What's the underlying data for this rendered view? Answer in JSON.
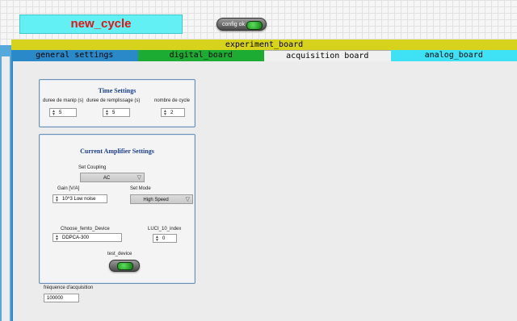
{
  "header": {
    "title": "new_cycle",
    "config_button_label": "config ok"
  },
  "experiment_bar": {
    "label": "experiment_board"
  },
  "tabs": [
    {
      "label": "general settings",
      "color": "#2a89c9"
    },
    {
      "label": "digital_board",
      "color": "#1cab33"
    },
    {
      "label": "acquisition board",
      "selected": true
    },
    {
      "label": "analog_board",
      "color": "#3ee2f4"
    }
  ],
  "time_settings": {
    "title": "Time Settings",
    "fields": [
      {
        "label": "duree de manip (s)",
        "value": "5"
      },
      {
        "label": "duree de remplissage (s)",
        "value": "5"
      },
      {
        "label": "nombre  de cycle",
        "value": "2"
      }
    ]
  },
  "amplifier": {
    "title": "Current Amplifier Settings",
    "coupling": {
      "label": "Set Coupling",
      "value": "AC"
    },
    "gain": {
      "label": "Gain  [V/A]",
      "value": "10^3 Low noise"
    },
    "mode": {
      "label": "Set Mode",
      "value": "High Speed"
    },
    "device": {
      "label": "Choose_femto_Device",
      "value": "DDPCA-300"
    },
    "luci_index": {
      "label": "LUCI_10_index",
      "value": "0"
    },
    "test_device": {
      "label": "test_device"
    }
  },
  "acquisition": {
    "label": "fréquence d'acquisition",
    "value": "100000"
  }
}
